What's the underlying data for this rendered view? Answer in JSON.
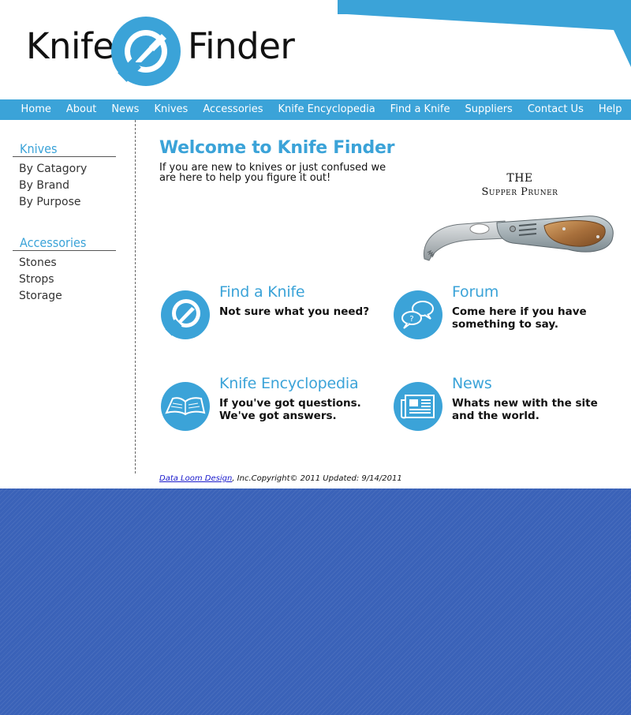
{
  "colors": {
    "accent": "#3ba3d8",
    "background": "#3a62b8"
  },
  "logo": {
    "word1": "Knife",
    "word2": "Finder"
  },
  "nav": {
    "items": [
      "Home",
      "About",
      "News",
      "Knives",
      "Accessories",
      "Knife Encyclopedia",
      "Find a Knife",
      "Suppliers",
      "Contact Us",
      "Help"
    ]
  },
  "sidebar": {
    "sections": [
      {
        "title": "Knives",
        "items": [
          "By Catagory",
          "By Brand",
          "By Purpose"
        ]
      },
      {
        "title": "Accessories",
        "items": [
          "Stones",
          "Strops",
          "Storage"
        ]
      }
    ]
  },
  "main": {
    "title": "Welcome to Knife Finder",
    "intro": "If you are new to knives or just confused we are here to help you figure it out!",
    "promo": {
      "line1": "THE",
      "line2": "Supper Pruner"
    },
    "features": [
      {
        "title": "Find a Knife",
        "desc": "Not sure what you need?",
        "icon": "magnifier-knife-icon"
      },
      {
        "title": "Forum",
        "desc": "Come here if you have something to say.",
        "icon": "speech-bubbles-icon"
      },
      {
        "title": "Knife Encyclopedia",
        "desc": "If you've got questions. We've got answers.",
        "icon": "open-book-icon"
      },
      {
        "title": "News",
        "desc": "Whats new with the site and the world.",
        "icon": "newspaper-icon"
      }
    ]
  },
  "footer": {
    "link": "Data Loom Design",
    "text": ", Inc.Copyright© 2011 Updated: 9/14/2011"
  }
}
